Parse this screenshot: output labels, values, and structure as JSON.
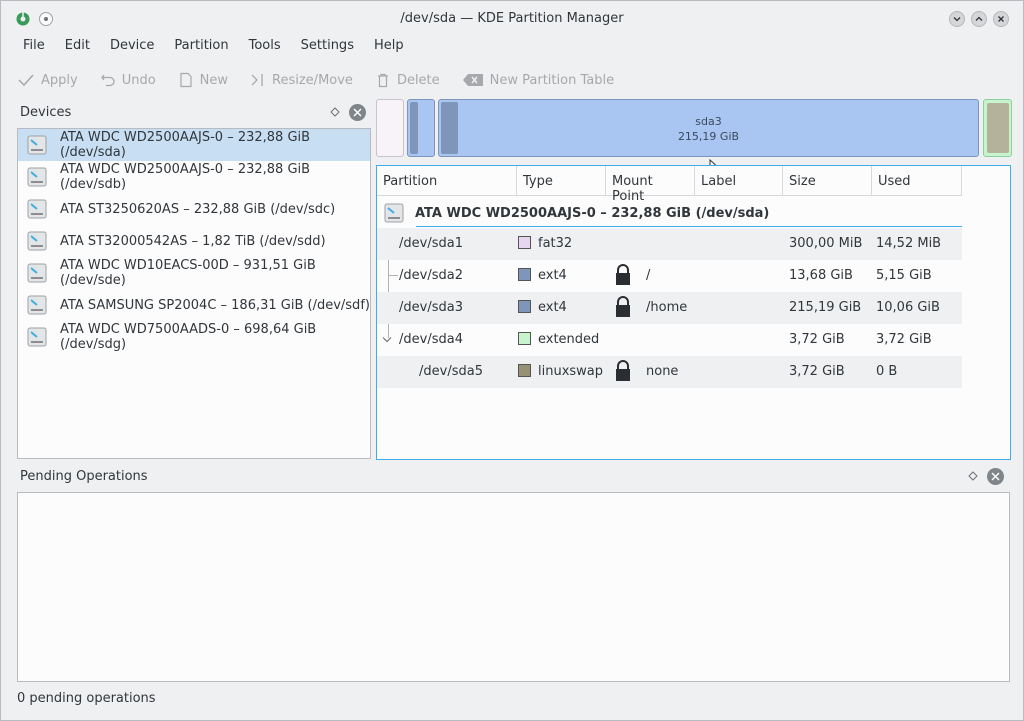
{
  "window": {
    "title": "/dev/sda — KDE Partition Manager"
  },
  "menu": [
    "File",
    "Edit",
    "Device",
    "Partition",
    "Tools",
    "Settings",
    "Help"
  ],
  "toolbar": {
    "apply": "Apply",
    "undo": "Undo",
    "new": "New",
    "resize_move": "Resize/Move",
    "delete": "Delete",
    "new_partition_table": "New Partition Table"
  },
  "devices_panel": {
    "title": "Devices",
    "items": [
      "ATA WDC WD2500AAJS-0 – 232,88 GiB (/dev/sda)",
      "ATA WDC WD2500AAJS-0 – 232,88 GiB (/dev/sdb)",
      "ATA ST3250620AS – 232,88 GiB (/dev/sdc)",
      "ATA ST32000542AS – 1,82 TiB (/dev/sdd)",
      "ATA WDC WD10EACS-00D – 931,51 GiB (/dev/sde)",
      "ATA SAMSUNG SP2004C – 186,31 GiB (/dev/sdf)",
      "ATA WDC WD7500AADS-0 – 698,64 GiB (/dev/sdg)"
    ]
  },
  "partition_bar": {
    "selected_label": "sda3",
    "selected_size": "215,19 GiB"
  },
  "partition_table": {
    "headers": [
      "Partition",
      "Type",
      "Mount Point",
      "Label",
      "Size",
      "Used"
    ],
    "device": "ATA WDC WD2500AAJS-0 – 232,88 GiB (/dev/sda)",
    "rows": [
      {
        "partition": "/dev/sda1",
        "type": "fat32",
        "color": "#e8d5ef",
        "mount": "",
        "size": "300,00 MiB",
        "used": "14,52 MiB"
      },
      {
        "partition": "/dev/sda2",
        "type": "ext4",
        "color": "#7f95b9",
        "mount": "/",
        "size": "13,68 GiB",
        "used": "5,15 GiB"
      },
      {
        "partition": "/dev/sda3",
        "type": "ext4",
        "color": "#7f95b9",
        "mount": "/home",
        "size": "215,19 GiB",
        "used": "10,06 GiB"
      },
      {
        "partition": "/dev/sda4",
        "type": "extended",
        "color": "#c7f4cf",
        "mount": "",
        "size": "3,72 GiB",
        "used": "3,72 GiB"
      },
      {
        "partition": "/dev/sda5",
        "type": "linuxswap",
        "color": "#979178",
        "mount": "none",
        "size": "3,72 GiB",
        "used": "0 B"
      }
    ]
  },
  "pending": {
    "title": "Pending Operations",
    "status": "0 pending operations"
  },
  "colors": {
    "selection": "#c8dff3",
    "accent": "#3daee9"
  }
}
